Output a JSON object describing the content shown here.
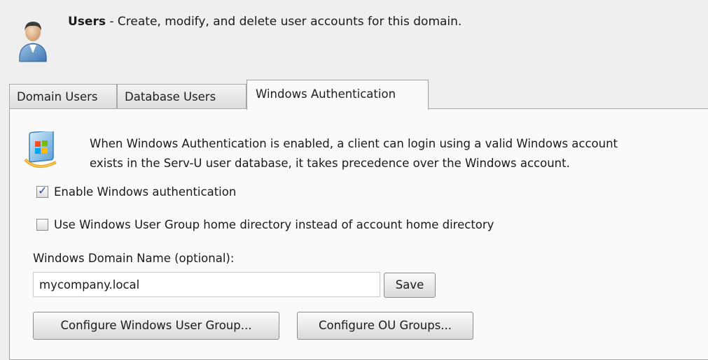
{
  "header": {
    "title": "Users",
    "description": " - Create, modify, and delete user accounts for this domain."
  },
  "tabs": [
    {
      "label": "Domain Users",
      "active": false
    },
    {
      "label": "Database Users",
      "active": false
    },
    {
      "label": "Windows Authentication",
      "active": true
    }
  ],
  "panel": {
    "description_line1": "When Windows Authentication is enabled, a client can login using a valid Windows account",
    "description_line2": "exists in the Serv-U user database, it takes precedence over the Windows account.",
    "enable_windows_auth": {
      "label": "Enable Windows authentication",
      "checked": true
    },
    "use_group_home_dir": {
      "label": "Use Windows User Group home directory instead of account home directory",
      "checked": false
    },
    "domain_name": {
      "label": "Windows Domain Name (optional):",
      "value": "mycompany.local"
    },
    "save_label": "Save",
    "configure_user_group_label": "Configure Windows User Group...",
    "configure_ou_groups_label": "Configure OU Groups..."
  },
  "icons": {
    "header_icon": "user-icon",
    "panel_icon": "windows-logo-icon"
  },
  "colors": {
    "background": "#efefef",
    "panel": "#fafafa",
    "checkmark": "#2a4bbd"
  }
}
